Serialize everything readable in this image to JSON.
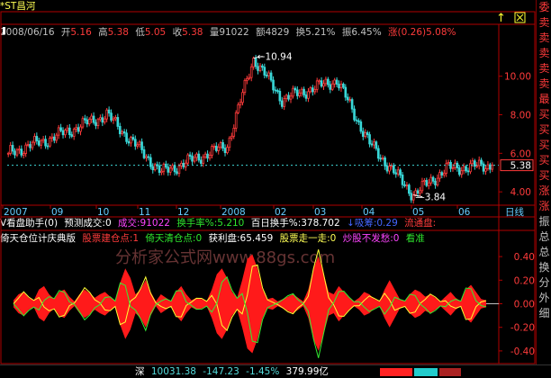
{
  "stock": {
    "name": "*ST昌河",
    "date": "2008/06/16",
    "open_label": "开",
    "open": "5.16",
    "high_label": "高",
    "high": "5.38",
    "low_label": "低",
    "low": "5.05",
    "close_label": "收",
    "close": "5.38",
    "volume_label": "量",
    "volume": "91022",
    "amount_label": "额",
    "amount": "4829",
    "turnover_label": "换",
    "turnover": "5.21%",
    "amplitude_label": "振",
    "amplitude": "6.45%",
    "change_label": "涨",
    "change": "(0.26)",
    "change_pct": "5.08%"
  },
  "indicator1": {
    "title": "V看盘助手(0)",
    "pred_label": "预测成交:",
    "pred_value": "0",
    "vol_label": "成交:",
    "vol_value": "91022",
    "turn_label": "换手率%",
    "turn_value": ":5.210",
    "hundred_label": "百日换手%",
    "hundred_value": ":378.702",
    "buy_label": "↓吸筹",
    "buy_value": ":0.29",
    "flow_label": "流通盘:"
  },
  "indicator2": {
    "title": "倚天仓位计庆典版",
    "t1": "股票建仓点:",
    "v1": "1",
    "t2": "倚天清仓点:",
    "v2": "0",
    "t3": "获利盘",
    "v3": ":65.459",
    "t4": "股票走一走:",
    "v4": "0",
    "t5": "炒股不发愁:",
    "v5": "0",
    "t6": "看准"
  },
  "watermark": "分析家公式网www.88gs.com",
  "sidebar": [
    "委",
    "卖",
    "卖",
    "卖",
    "卖",
    "卖",
    "最",
    "买",
    "买",
    "买",
    "买",
    "买",
    "涨",
    "涨",
    "振",
    "总",
    "总",
    "换",
    "分",
    "外",
    "细"
  ],
  "time_axis_label": "日线",
  "status": {
    "market": "深",
    "index": "10031.38",
    "change": "-147.23",
    "pct": "-1.45%",
    "amount": "379.99亿"
  },
  "colors": {
    "up": "#ff3b3b",
    "down": "#38d8d8",
    "axis": "#b00000",
    "osc_fill": "#ff1a1a",
    "osc_line_a": "#ffff33",
    "osc_line_b": "#33ee33"
  },
  "chart_data": [
    {
      "type": "candlestick",
      "ylim": [
        3.4,
        11.9
      ],
      "yticks": [
        4.0,
        6.0,
        8.0,
        10.0
      ],
      "ytick_labels": [
        "4.00",
        "6.00",
        "8.00",
        "10.00"
      ],
      "x_labels": [
        "2007",
        "09",
        "10",
        "11",
        "12",
        "2008",
        "02",
        "03",
        "04",
        "05",
        "06"
      ],
      "current_price": 5.38,
      "current_price_label": "5.38",
      "max": {
        "value": 10.94,
        "label": "10.94",
        "index": 112
      },
      "min": {
        "value": 3.84,
        "label": "3.84",
        "index": 185
      },
      "start_price": 6.0,
      "candle_count": 222
    },
    {
      "type": "line",
      "ylim": [
        -0.5,
        0.5
      ],
      "yticks": [
        0.4,
        0.2,
        0.0,
        -0.2,
        -0.4
      ],
      "ytick_labels": [
        "0.40",
        "0.20",
        "0.00",
        "-0.20",
        "-0.40"
      ],
      "series": [
        {
          "name": "envelope",
          "values": [
            0.03,
            0.08,
            0.1,
            0.05,
            0.03,
            0.12,
            0.15,
            0.08,
            0.04,
            0.1,
            0.12,
            0.06,
            0.02,
            0.08,
            0.12,
            0.09,
            0.05,
            0.08,
            0.1,
            0.06,
            0.02,
            0.18,
            0.3,
            0.22,
            0.08,
            0.12,
            0.2,
            0.1,
            0.02,
            0.08,
            0.05,
            0.02,
            0.1,
            0.15,
            0.08,
            0.03,
            0.05,
            0.04,
            0.02,
            0.12,
            0.25,
            0.3,
            0.22,
            0.1,
            0.05,
            0.2,
            0.38,
            0.42,
            0.3,
            0.12,
            0.04,
            0.05,
            0.02,
            0.04,
            0.06,
            0.08,
            0.05,
            0.02,
            0.12,
            0.3,
            0.4,
            0.26,
            0.1,
            0.08,
            0.15,
            0.1,
            0.05,
            0.02,
            0.05,
            0.1,
            0.08,
            0.04,
            0.02,
            0.12,
            0.2,
            0.12,
            0.04,
            0.02,
            0.08,
            0.12,
            0.1,
            0.06,
            0.08,
            0.05,
            0.02,
            0.06,
            0.1,
            0.05,
            0.02,
            0.12,
            0.16,
            0.1,
            0.04,
            0.03
          ]
        }
      ]
    }
  ]
}
